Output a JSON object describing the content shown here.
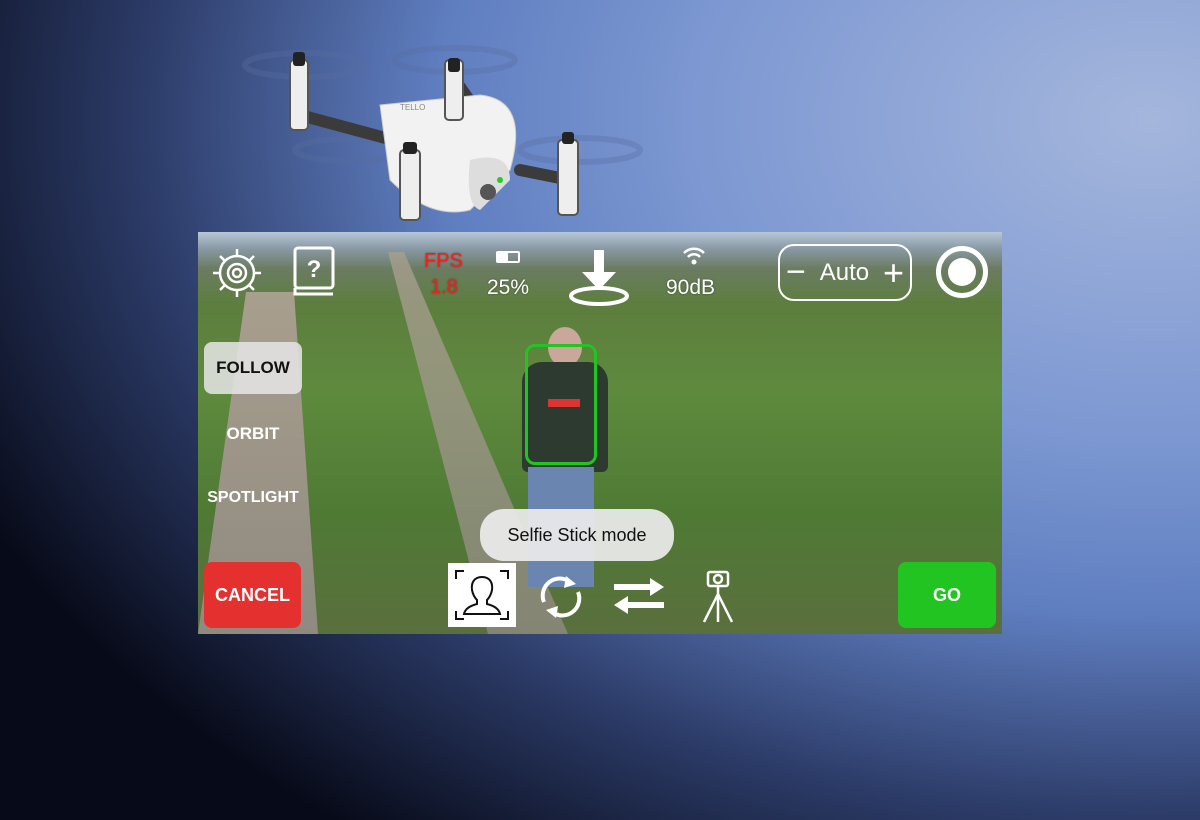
{
  "hud": {
    "fps_label": "FPS",
    "fps_value": "1.8",
    "battery": "25%",
    "signal": "90dB",
    "zoom_mode": "Auto",
    "minus": "−",
    "plus": "+"
  },
  "modes": [
    {
      "label": "FOLLOW",
      "selected": true
    },
    {
      "label": "ORBIT"
    },
    {
      "label": "SPOTLIGHT"
    }
  ],
  "toast": "Selfie Stick mode",
  "buttons": {
    "cancel": "CANCEL",
    "go": "GO"
  },
  "colors": {
    "fps": "#ff1a1a",
    "cancel": "#e53030",
    "go": "#22c422",
    "tracking_box": "#22c422"
  },
  "battery_level": 0.25,
  "drone_brand": "TELLO"
}
